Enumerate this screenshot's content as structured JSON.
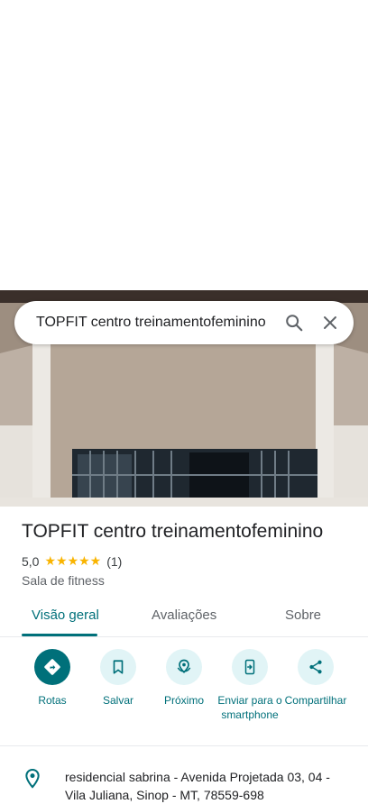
{
  "search": {
    "query": "TOPFIT centro treinamentofeminino"
  },
  "place": {
    "name": "TOPFIT centro treinamentofeminino",
    "rating": "5,0",
    "stars": "★★★★★",
    "review_count": "(1)",
    "category": "Sala de fitness"
  },
  "tabs": [
    {
      "label": "Visão geral",
      "active": true
    },
    {
      "label": "Avaliações",
      "active": false
    },
    {
      "label": "Sobre",
      "active": false
    }
  ],
  "actions": [
    {
      "label": "Rotas",
      "icon": "directions-icon"
    },
    {
      "label": "Salvar",
      "icon": "bookmark-icon"
    },
    {
      "label": "Próximo",
      "icon": "nearby-icon"
    },
    {
      "label": "Enviar para o smartphone",
      "icon": "send-to-phone-icon"
    },
    {
      "label": "Compartilhar",
      "icon": "share-icon"
    }
  ],
  "address": "residencial sabrina - Avenida Projetada 03, 04 - Vila Juliana, Sinop - MT, 78559-698",
  "colors": {
    "accent": "#00707a",
    "accent_light": "#e1f4f6",
    "star": "#f9b400"
  }
}
